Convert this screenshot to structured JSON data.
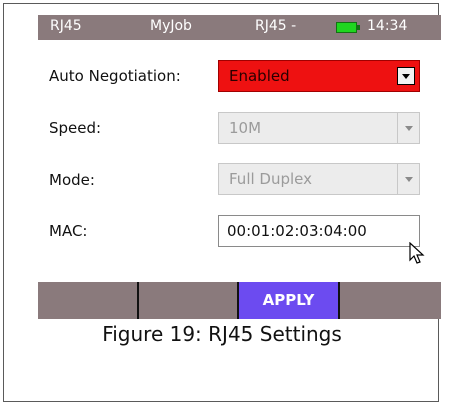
{
  "status_bar": {
    "port": "RJ45",
    "job": "MyJob",
    "mode": "RJ45 -",
    "time": "14:34",
    "battery_color": "#1fd61f"
  },
  "settings": {
    "auto_negotiation": {
      "label": "Auto Negotiation:",
      "value": "Enabled",
      "color": "#ee1111"
    },
    "speed": {
      "label": "Speed:",
      "value": "10M",
      "disabled": true
    },
    "mode": {
      "label": "Mode:",
      "value": "Full Duplex",
      "disabled": true
    },
    "mac": {
      "label": "MAC:",
      "value": "00:01:02:03:04:00"
    }
  },
  "toolbar": {
    "apply_label": "APPLY",
    "apply_color": "#6c4bf0"
  },
  "caption": "Figure 19: RJ45 Settings"
}
